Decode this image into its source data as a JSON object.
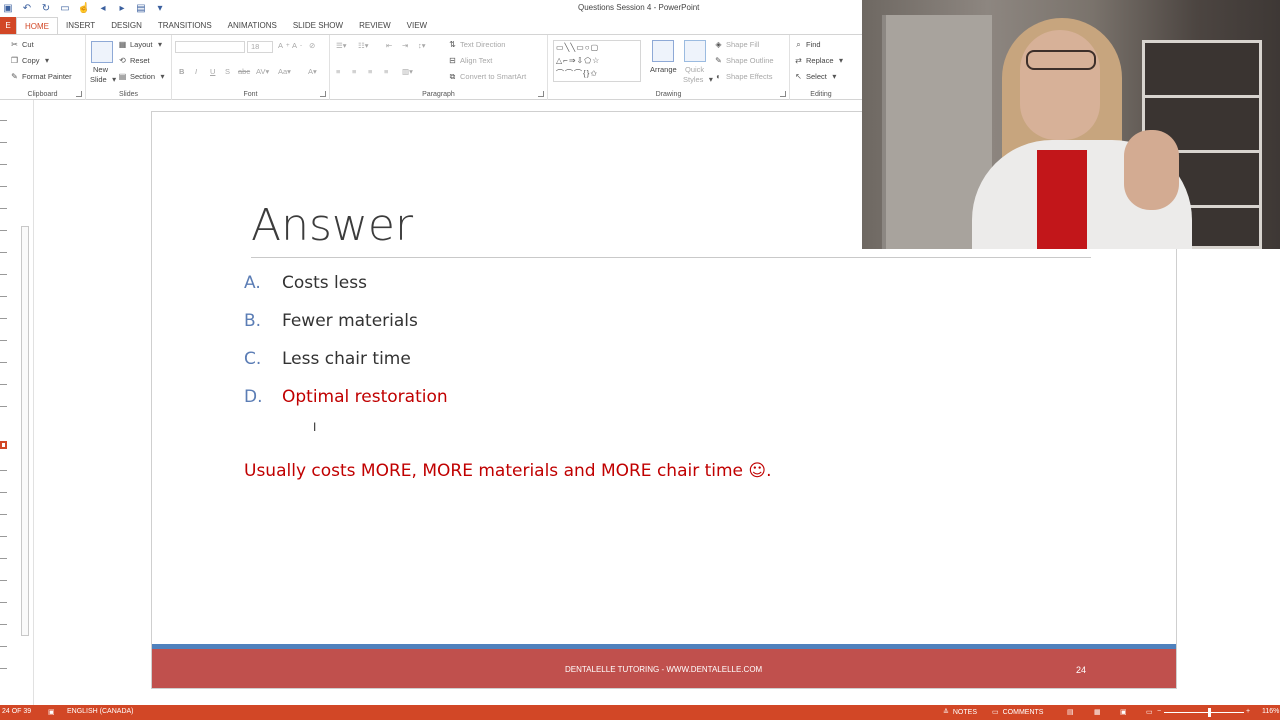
{
  "window": {
    "title": "Questions Session 4 - PowerPoint"
  },
  "quick_access": [
    "save-icon",
    "undo-icon",
    "redo-icon",
    "start-from-beginning-icon"
  ],
  "tabs": [
    {
      "label": "HOME"
    },
    {
      "label": "INSERT"
    },
    {
      "label": "DESIGN"
    },
    {
      "label": "TRANSITIONS"
    },
    {
      "label": "ANIMATIONS"
    },
    {
      "label": "SLIDE SHOW"
    },
    {
      "label": "REVIEW"
    },
    {
      "label": "VIEW"
    }
  ],
  "ribbon": {
    "clipboard": {
      "cut": "Cut",
      "copy": "Copy",
      "format_painter": "Format Painter",
      "label": "Clipboard"
    },
    "slides": {
      "new_slide_1": "New",
      "new_slide_2": "Slide",
      "layout": "Layout",
      "reset": "Reset",
      "section": "Section",
      "label": "Slides"
    },
    "font": {
      "size": "18",
      "label": "Font"
    },
    "paragraph": {
      "text_direction": "Text Direction",
      "align_text": "Align Text",
      "convert_smartart": "Convert to SmartArt",
      "label": "Paragraph"
    },
    "drawing": {
      "arrange": "Arrange",
      "quick_styles_1": "Quick",
      "quick_styles_2": "Styles",
      "shape_fill": "Shape Fill",
      "shape_outline": "Shape Outline",
      "shape_effects": "Shape Effects",
      "label": "Drawing"
    },
    "editing": {
      "find": "Find",
      "replace": "Replace",
      "select": "Select",
      "label": "Editing"
    }
  },
  "slide": {
    "title": "Answer",
    "answers": [
      {
        "letter": "A.",
        "text": "Costs less"
      },
      {
        "letter": "B.",
        "text": "Fewer materials"
      },
      {
        "letter": "C.",
        "text": "Less chair time"
      },
      {
        "letter": "D.",
        "text": "Optimal restoration"
      }
    ],
    "note": "Usually costs MORE, MORE materials and MORE chair time ☺.",
    "footer": "DENTALELLE TUTORING - WWW.DENTALELLE.COM",
    "number": "24"
  },
  "statusbar": {
    "slide_position": "24 OF 39",
    "language": "ENGLISH (CANADA)",
    "notes": "NOTES",
    "comments": "COMMENTS",
    "zoom": "116%"
  },
  "colors": {
    "accent": "#d24726",
    "footer_red": "#c0504d",
    "footer_blue": "#4f81bd",
    "correct": "#c00000",
    "letters": "#5b7db5"
  }
}
